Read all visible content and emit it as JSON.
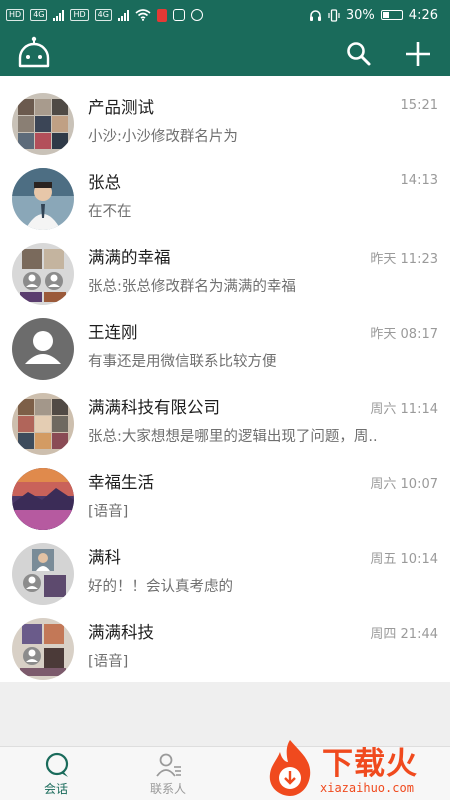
{
  "status_bar": {
    "left_chips": [
      "HD",
      "4G",
      "HD",
      "4G"
    ],
    "battery": "30%",
    "time": "4:26"
  },
  "colors": {
    "primary": "#1a6b5b",
    "accent_red": "#f04a1e"
  },
  "chats": [
    {
      "name": "产品测试",
      "time": "15:21",
      "preview": "小沙:小沙修改群名片为"
    },
    {
      "name": "张总",
      "time": "14:13",
      "preview": "在不在"
    },
    {
      "name": "满满的幸福",
      "time": "昨天 11:23",
      "preview": "张总:张总修改群名为满满的幸福"
    },
    {
      "name": "王连刚",
      "time": "昨天 08:17",
      "preview": "有事还是用微信联系比较方便"
    },
    {
      "name": "满满科技有限公司",
      "time": "周六 11:14",
      "preview": "张总:大家想想是哪里的逻辑出现了问题，周.."
    },
    {
      "name": "幸福生活",
      "time": "周六 10:07",
      "preview": "[语音]"
    },
    {
      "name": "满科",
      "time": "周五 10:14",
      "preview": "好的！！会认真考虑的"
    },
    {
      "name": "满满科技",
      "time": "周四 21:44",
      "preview": "[语音]"
    }
  ],
  "tabs": [
    {
      "label": "会话",
      "icon": "chat-bubble-icon"
    },
    {
      "label": "联系人",
      "icon": "contacts-icon"
    }
  ],
  "watermark": {
    "text": "下载火",
    "sub": "xiazaihuo.com"
  }
}
